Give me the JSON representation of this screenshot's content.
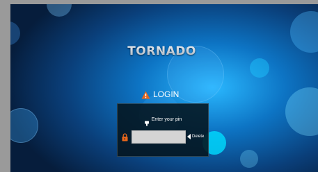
{
  "brand": {
    "name": "TORNADO"
  },
  "login": {
    "heading": "LOGIN",
    "heading_icon": "warning-icon",
    "prompt": "Enter your pin",
    "prompt_icon": "finger-pointer-icon",
    "pin_value": "",
    "lock_icon": "lock-icon",
    "delete_label": "Delete",
    "delete_icon": "left-arrow-icon"
  },
  "colors": {
    "accent": "#e8671c",
    "background_center": "#2ab8ff",
    "background_edge": "#061d3c",
    "panel": "#05141e"
  }
}
